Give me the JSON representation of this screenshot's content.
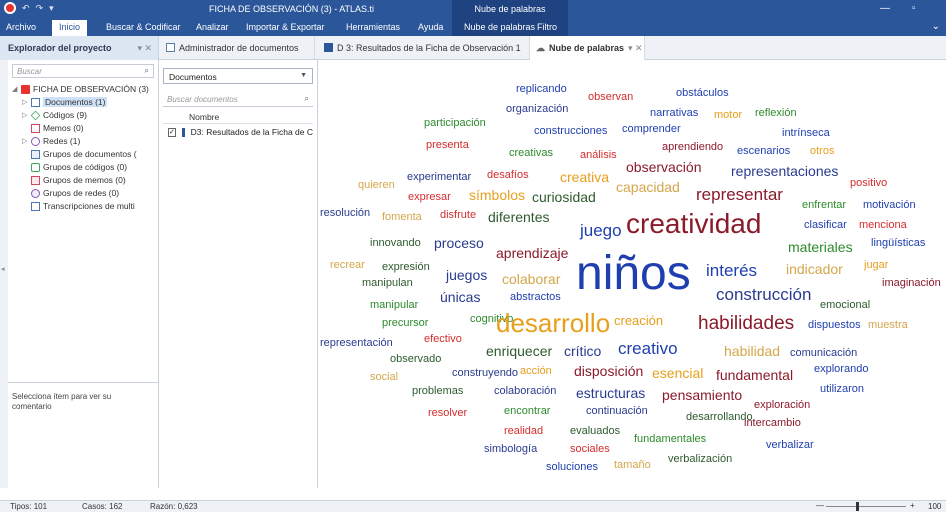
{
  "titlebar": {
    "title": "FICHA DE OBSERVACIÓN (3) - ATLAS.ti",
    "context_label": "Nube de palabras",
    "quick_access": [
      "↶",
      "↷",
      "▾"
    ]
  },
  "ribbon": {
    "tabs": [
      "Archivo",
      "Inicio",
      "Buscar & Codificar",
      "Analizar",
      "Importar & Exportar",
      "Herramientas",
      "Ayuda",
      "Nube de palabras",
      "Filtro"
    ],
    "active": "Inicio"
  },
  "explorer": {
    "title": "Explorador del proyecto",
    "search_placeholder": "Buscar",
    "project": "FICHA DE OBSERVACIÓN (3)",
    "nodes": [
      "Documentos (1)",
      "Códigos (9)",
      "Memos (0)",
      "Redes (1)",
      "Grupos de documentos (",
      "Grupos de códigos (0)",
      "Grupos de memos (0)",
      "Grupos de redes (0)",
      "Transcripciones de multi"
    ],
    "comment": "Selecciona ítem para ver su comentario"
  },
  "doc_tabs": [
    "Administrador de documentos",
    "D 3: Resultados de la Ficha de Observación 1",
    "Nube de palabras"
  ],
  "docmgr": {
    "dropdown": "Documentos",
    "search_placeholder": "Buscar documentos",
    "column": "Nombre",
    "rows": [
      "D3: Resultados de la Ficha de C"
    ]
  },
  "cloud": {
    "words": [
      {
        "t": "replicando",
        "c": "#1f3fb0",
        "s": 11
      },
      {
        "t": "obstáculos",
        "c": "#1f3fb0",
        "s": 11
      },
      {
        "t": "observan",
        "c": "#d42d2d",
        "s": 11
      },
      {
        "t": "organización",
        "c": "#2a3b8f",
        "s": 11
      },
      {
        "t": "narrativas",
        "c": "#1f3fb0",
        "s": 11
      },
      {
        "t": "motor",
        "c": "#e6a01c",
        "s": 11
      },
      {
        "t": "reflexión",
        "c": "#2e8b2e",
        "s": 11
      },
      {
        "t": "participación",
        "c": "#2e8b2e",
        "s": 11
      },
      {
        "t": "comprender",
        "c": "#1f3fb0",
        "s": 11
      },
      {
        "t": "construcciones",
        "c": "#1f3fb0",
        "s": 11
      },
      {
        "t": "intrínseca",
        "c": "#1f3fb0",
        "s": 11
      },
      {
        "t": "presenta",
        "c": "#d42d2d",
        "s": 11
      },
      {
        "t": "aprendiendo",
        "c": "#8b1a2b",
        "s": 11
      },
      {
        "t": "creativas",
        "c": "#2e8b2e",
        "s": 11
      },
      {
        "t": "análisis",
        "c": "#d42d2d",
        "s": 11
      },
      {
        "t": "escenarios",
        "c": "#1f3fb0",
        "s": 11
      },
      {
        "t": "otros",
        "c": "#e6a01c",
        "s": 11
      },
      {
        "t": "observación",
        "c": "#8b1a2b",
        "s": 14
      },
      {
        "t": "experimentar",
        "c": "#2a3b8f",
        "s": 11
      },
      {
        "t": "desafíos",
        "c": "#d42d2d",
        "s": 11
      },
      {
        "t": "creativa",
        "c": "#e6a01c",
        "s": 14
      },
      {
        "t": "representaciones",
        "c": "#2a3b8f",
        "s": 14
      },
      {
        "t": "quieren",
        "c": "#d4a64a",
        "s": 11
      },
      {
        "t": "capacidad",
        "c": "#d4a64a",
        "s": 14
      },
      {
        "t": "positivo",
        "c": "#d42d2d",
        "s": 11
      },
      {
        "t": "expresar",
        "c": "#d42d2d",
        "s": 11
      },
      {
        "t": "símbolos",
        "c": "#e6a01c",
        "s": 14
      },
      {
        "t": "curiosidad",
        "c": "#2e5a2e",
        "s": 14
      },
      {
        "t": "representar",
        "c": "#8b1a2b",
        "s": 17
      },
      {
        "t": "enfrentar",
        "c": "#2e8b2e",
        "s": 11
      },
      {
        "t": "motivación",
        "c": "#1f3fb0",
        "s": 11
      },
      {
        "t": "resolución",
        "c": "#2a3b8f",
        "s": 11
      },
      {
        "t": "fomenta",
        "c": "#d4a64a",
        "s": 11
      },
      {
        "t": "disfrute",
        "c": "#d42d2d",
        "s": 11
      },
      {
        "t": "diferentes",
        "c": "#2e5a2e",
        "s": 14
      },
      {
        "t": "clasificar",
        "c": "#1f3fb0",
        "s": 11
      },
      {
        "t": "menciona",
        "c": "#d42d2d",
        "s": 11
      },
      {
        "t": "juego",
        "c": "#1f3fb0",
        "s": 17
      },
      {
        "t": "creatividad",
        "c": "#8b1a2b",
        "s": 28
      },
      {
        "t": "materiales",
        "c": "#2e8b2e",
        "s": 14
      },
      {
        "t": "lingüísticas",
        "c": "#1f3fb0",
        "s": 11
      },
      {
        "t": "innovando",
        "c": "#2e5a2e",
        "s": 11
      },
      {
        "t": "proceso",
        "c": "#2a3b8f",
        "s": 14
      },
      {
        "t": "aprendizaje",
        "c": "#8b1a2b",
        "s": 14
      },
      {
        "t": "recrear",
        "c": "#d4a64a",
        "s": 11
      },
      {
        "t": "expresión",
        "c": "#2e5a2e",
        "s": 11
      },
      {
        "t": "interés",
        "c": "#1f3fb0",
        "s": 17
      },
      {
        "t": "indicador",
        "c": "#d4a64a",
        "s": 14
      },
      {
        "t": "jugar",
        "c": "#e6a01c",
        "s": 11
      },
      {
        "t": "juegos",
        "c": "#2a3b8f",
        "s": 14
      },
      {
        "t": "colaborar",
        "c": "#d4a64a",
        "s": 14
      },
      {
        "t": "niños",
        "c": "#1f3fb0",
        "s": 48
      },
      {
        "t": "imaginación",
        "c": "#8b1a2b",
        "s": 11
      },
      {
        "t": "manipulan",
        "c": "#2e5a2e",
        "s": 11
      },
      {
        "t": "construcción",
        "c": "#2a3b8f",
        "s": 17
      },
      {
        "t": "únicas",
        "c": "#2a3b8f",
        "s": 14
      },
      {
        "t": "abstractos",
        "c": "#1f3fb0",
        "s": 11
      },
      {
        "t": "manipular",
        "c": "#2e8b2e",
        "s": 11
      },
      {
        "t": "emocional",
        "c": "#2e5a2e",
        "s": 11
      },
      {
        "t": "cognitivo",
        "c": "#2e8b2e",
        "s": 11
      },
      {
        "t": "creación",
        "c": "#e6a01c",
        "s": 13
      },
      {
        "t": "precursor",
        "c": "#2e8b2e",
        "s": 11
      },
      {
        "t": "desarrollo",
        "c": "#e6a01c",
        "s": 26
      },
      {
        "t": "habilidades",
        "c": "#8b1a2b",
        "s": 19
      },
      {
        "t": "dispuestos",
        "c": "#1f3fb0",
        "s": 11
      },
      {
        "t": "muestra",
        "c": "#d4a64a",
        "s": 11
      },
      {
        "t": "efectivo",
        "c": "#d42d2d",
        "s": 11
      },
      {
        "t": "representación",
        "c": "#2a3b8f",
        "s": 11
      },
      {
        "t": "creativo",
        "c": "#1f3fb0",
        "s": 17
      },
      {
        "t": "enriquecer",
        "c": "#2e5a2e",
        "s": 14
      },
      {
        "t": "crítico",
        "c": "#2a3b8f",
        "s": 14
      },
      {
        "t": "habilidad",
        "c": "#d4a64a",
        "s": 14
      },
      {
        "t": "comunicación",
        "c": "#2a3b8f",
        "s": 11
      },
      {
        "t": "observado",
        "c": "#2e5a2e",
        "s": 11
      },
      {
        "t": "explorando",
        "c": "#1f3fb0",
        "s": 11
      },
      {
        "t": "construyendo",
        "c": "#2a3b8f",
        "s": 11
      },
      {
        "t": "acción",
        "c": "#e6a01c",
        "s": 11
      },
      {
        "t": "disposición",
        "c": "#8b1a2b",
        "s": 14
      },
      {
        "t": "esencial",
        "c": "#e6a01c",
        "s": 14
      },
      {
        "t": "fundamental",
        "c": "#8b1a2b",
        "s": 14
      },
      {
        "t": "social",
        "c": "#d4a64a",
        "s": 11
      },
      {
        "t": "utilizaron",
        "c": "#1f3fb0",
        "s": 11
      },
      {
        "t": "problemas",
        "c": "#2e5a2e",
        "s": 11
      },
      {
        "t": "colaboración",
        "c": "#2a3b8f",
        "s": 11
      },
      {
        "t": "estructuras",
        "c": "#2a3b8f",
        "s": 14
      },
      {
        "t": "pensamiento",
        "c": "#8b1a2b",
        "s": 14
      },
      {
        "t": "exploración",
        "c": "#8b1a2b",
        "s": 11
      },
      {
        "t": "resolver",
        "c": "#d42d2d",
        "s": 11
      },
      {
        "t": "encontrar",
        "c": "#2e8b2e",
        "s": 11
      },
      {
        "t": "continuación",
        "c": "#2a3b8f",
        "s": 11
      },
      {
        "t": "desarrollando",
        "c": "#2e5a2e",
        "s": 11
      },
      {
        "t": "intercambio",
        "c": "#8b1a2b",
        "s": 11
      },
      {
        "t": "realidad",
        "c": "#d42d2d",
        "s": 11
      },
      {
        "t": "evaluados",
        "c": "#2e5a2e",
        "s": 11
      },
      {
        "t": "fundamentales",
        "c": "#2e8b2e",
        "s": 11
      },
      {
        "t": "verbalizar",
        "c": "#1f3fb0",
        "s": 11
      },
      {
        "t": "simbología",
        "c": "#2a3b8f",
        "s": 11
      },
      {
        "t": "sociales",
        "c": "#d42d2d",
        "s": 11
      },
      {
        "t": "verbalización",
        "c": "#2e5a2e",
        "s": 11
      },
      {
        "t": "tamaño",
        "c": "#d4a64a",
        "s": 11
      },
      {
        "t": "soluciones",
        "c": "#1f3fb0",
        "s": 11
      }
    ]
  },
  "status": {
    "tipos": "Tipos: 101",
    "casos": "Casos: 162",
    "razon": "Razón: 0,623",
    "zoom": "100",
    "zoom_level": 100
  }
}
